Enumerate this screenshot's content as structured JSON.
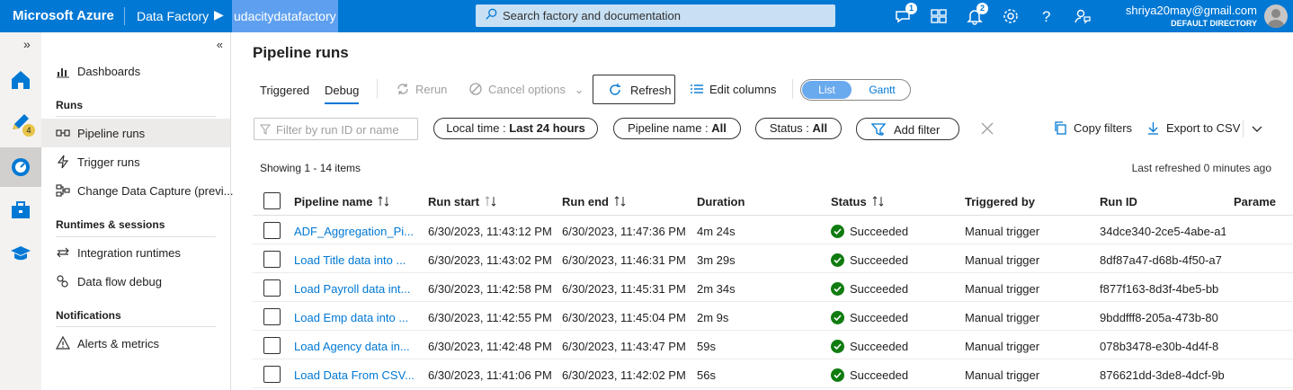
{
  "topbar": {
    "brand": "Microsoft Azure",
    "crumb_service": "Data Factory",
    "crumb_factory": "udacitydatafactory",
    "search_placeholder": "Search factory and documentation",
    "feedback_badge": "1",
    "notifications_badge": "2",
    "user_email": "shriya20may@gmail.com",
    "user_directory": "DEFAULT DIRECTORY"
  },
  "rail": {
    "author_badge": "4"
  },
  "nav": {
    "dashboards": "Dashboards",
    "section_runs": "Runs",
    "pipeline_runs": "Pipeline runs",
    "trigger_runs": "Trigger runs",
    "change_data_capture": "Change Data Capture (previ...",
    "section_runtimes": "Runtimes & sessions",
    "integration_runtimes": "Integration runtimes",
    "data_flow_debug": "Data flow debug",
    "section_notifications": "Notifications",
    "alerts_metrics": "Alerts & metrics"
  },
  "main": {
    "title": "Pipeline runs",
    "tab_triggered": "Triggered",
    "tab_debug": "Debug",
    "rerun": "Rerun",
    "cancel_options": "Cancel options",
    "refresh": "Refresh",
    "edit_columns": "Edit columns",
    "view_list": "List",
    "view_gantt": "Gantt",
    "filter_placeholder": "Filter by run ID or name",
    "filter_time_label": "Local time : ",
    "filter_time_value": "Last 24 hours",
    "filter_pipeline_label": "Pipeline name : ",
    "filter_pipeline_value": "All",
    "filter_status_label": "Status : ",
    "filter_status_value": "All",
    "add_filter": "Add filter",
    "copy_filters": "Copy filters",
    "export_csv": "Export to CSV",
    "showing": "Showing 1 - 14 items",
    "last_refreshed": "Last refreshed 0 minutes ago"
  },
  "table": {
    "columns": [
      "Pipeline name",
      "Run start",
      "Run end",
      "Duration",
      "Status",
      "Triggered by",
      "Run ID",
      "Parame"
    ],
    "rows": [
      {
        "name": "ADF_Aggregation_Pi...",
        "start": "6/30/2023, 11:43:12 PM",
        "end": "6/30/2023, 11:47:36 PM",
        "duration": "4m 24s",
        "status": "Succeeded",
        "trigger": "Manual trigger",
        "run_id": "34dce340-2ce5-4abe-a1"
      },
      {
        "name": "Load Title data into ...",
        "start": "6/30/2023, 11:43:02 PM",
        "end": "6/30/2023, 11:46:31 PM",
        "duration": "3m 29s",
        "status": "Succeeded",
        "trigger": "Manual trigger",
        "run_id": "8df87a47-d68b-4f50-a7"
      },
      {
        "name": "Load Payroll data int...",
        "start": "6/30/2023, 11:42:58 PM",
        "end": "6/30/2023, 11:45:31 PM",
        "duration": "2m 34s",
        "status": "Succeeded",
        "trigger": "Manual trigger",
        "run_id": "f877f163-8d3f-4be5-bb"
      },
      {
        "name": "Load Emp data into ...",
        "start": "6/30/2023, 11:42:55 PM",
        "end": "6/30/2023, 11:45:04 PM",
        "duration": "2m 9s",
        "status": "Succeeded",
        "trigger": "Manual trigger",
        "run_id": "9bddfff8-205a-473b-80"
      },
      {
        "name": "Load Agency data in...",
        "start": "6/30/2023, 11:42:48 PM",
        "end": "6/30/2023, 11:43:47 PM",
        "duration": "59s",
        "status": "Succeeded",
        "trigger": "Manual trigger",
        "run_id": "078b3478-e30b-4d4f-8"
      },
      {
        "name": "Load Data From CSV...",
        "start": "6/30/2023, 11:41:06 PM",
        "end": "6/30/2023, 11:42:02 PM",
        "duration": "56s",
        "status": "Succeeded",
        "trigger": "Manual trigger",
        "run_id": "876621dd-3de8-4dcf-9b"
      }
    ]
  },
  "colors": {
    "azure_blue": "#0078d4",
    "success_green": "#107c10"
  }
}
